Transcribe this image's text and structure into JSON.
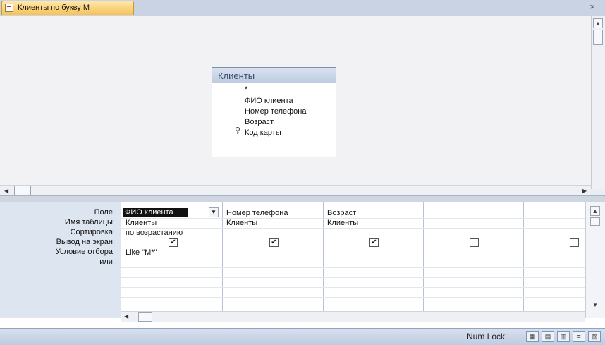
{
  "tab": {
    "title": "Клиенты по букву М"
  },
  "table": {
    "title": "Клиенты",
    "fields": [
      "*",
      "ФИО клиента",
      "Номер телефона",
      "Возраст",
      "Код карты"
    ]
  },
  "qbe": {
    "row_labels": [
      "Поле:",
      "Имя таблицы:",
      "Сортировка:",
      "Вывод на экран:",
      "Условие отбора:",
      "или:"
    ],
    "columns": [
      {
        "field": "ФИО клиента",
        "table": "Клиенты",
        "sort": "по возрастанию",
        "show": true,
        "criteria": "Like \"M*\""
      },
      {
        "field": "Номер телефона",
        "table": "Клиенты",
        "sort": "",
        "show": true,
        "criteria": ""
      },
      {
        "field": "Возраст",
        "table": "Клиенты",
        "sort": "",
        "show": true,
        "criteria": ""
      },
      {
        "field": "",
        "table": "",
        "sort": "",
        "show": false,
        "criteria": ""
      },
      {
        "field": "",
        "table": "",
        "sort": "",
        "show": false,
        "criteria": ""
      }
    ]
  },
  "status": {
    "numlock": "Num Lock"
  },
  "icons": {
    "check": "✔",
    "close": "×",
    "key": "key-icon"
  }
}
